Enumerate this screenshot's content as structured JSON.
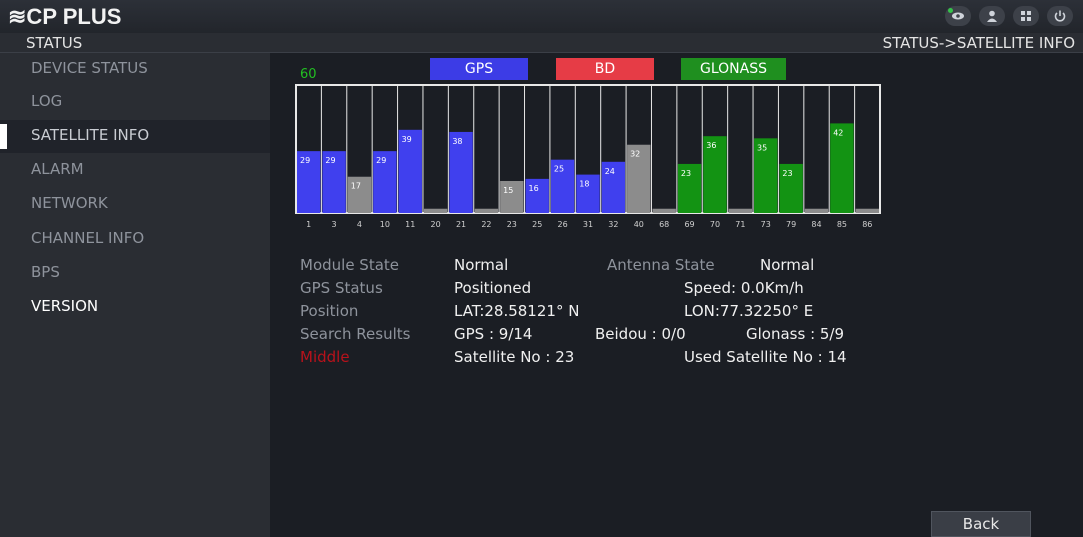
{
  "app": {
    "logo": "≋CP PLUS",
    "icons": [
      "view-icon",
      "user-icon",
      "grid-icon",
      "power-icon"
    ]
  },
  "header": {
    "section": "STATUS",
    "breadcrumb": "STATUS->SATELLITE INFO"
  },
  "sidebar": {
    "items": [
      {
        "label": "DEVICE STATUS"
      },
      {
        "label": "LOG"
      },
      {
        "label": "SATELLITE INFO",
        "active": true
      },
      {
        "label": "ALARM"
      },
      {
        "label": "NETWORK"
      },
      {
        "label": "CHANNEL INFO"
      },
      {
        "label": "BPS"
      },
      {
        "label": "VERSION"
      }
    ]
  },
  "legend": {
    "gps": "GPS",
    "bd": "BD",
    "glonass": "GLONASS",
    "scale_max": "60"
  },
  "colors": {
    "gps": "#4040ee",
    "glonass": "#139313",
    "unused": "#8c8c8c",
    "bd": "#e63c46"
  },
  "chart_data": {
    "type": "bar",
    "ylim": [
      0,
      60
    ],
    "categories": [
      "1",
      "3",
      "4",
      "10",
      "11",
      "20",
      "21",
      "22",
      "23",
      "25",
      "26",
      "31",
      "32",
      "40",
      "68",
      "69",
      "70",
      "71",
      "73",
      "79",
      "84",
      "85",
      "86"
    ],
    "values": [
      29,
      29,
      17,
      29,
      39,
      2,
      38,
      2,
      15,
      16,
      25,
      18,
      24,
      32,
      2,
      23,
      36,
      2,
      35,
      23,
      2,
      42,
      2
    ],
    "value_labels": [
      "29",
      "29",
      "17",
      "29",
      "39",
      "",
      "38",
      "",
      "15",
      "16",
      "25",
      "18",
      "24",
      "32",
      "",
      "23",
      "36",
      "",
      "35",
      "23",
      "",
      "42",
      ""
    ],
    "constellation": [
      "gps",
      "gps",
      "unused",
      "gps",
      "gps",
      "unused",
      "gps",
      "unused",
      "unused",
      "gps",
      "gps",
      "gps",
      "gps",
      "unused",
      "unused",
      "glonass",
      "glonass",
      "unused",
      "glonass",
      "glonass",
      "unused",
      "glonass",
      "unused"
    ]
  },
  "info": {
    "module_state_label": "Module State",
    "module_state_value": "Normal",
    "antenna_state_label": "Antenna State",
    "antenna_state_value": "Normal",
    "gps_status_label": "GPS Status",
    "gps_status_value": "Positioned",
    "speed": "Speed: 0.0Km/h",
    "position_label": "Position",
    "lat": "LAT:28.58121° N",
    "lon": "LON:77.32250° E",
    "search_results_label": "Search Results",
    "gps_count": "GPS : 9/14",
    "beidou_count": "Beidou : 0/0",
    "glonass_count": "Glonass : 5/9",
    "accuracy_label": "Middle",
    "satellite_no": "Satellite No : 23",
    "used_satellite_no": "Used Satellite No : 14"
  },
  "buttons": {
    "back": "Back"
  }
}
